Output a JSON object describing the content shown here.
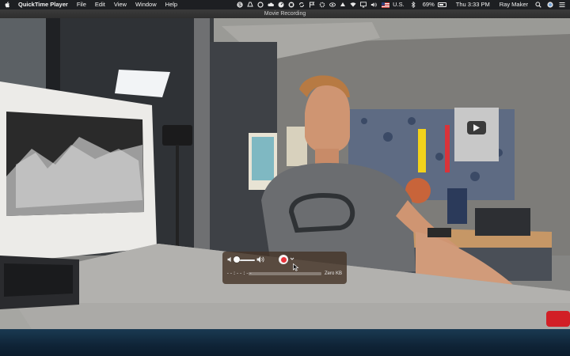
{
  "menubar": {
    "app_name": "QuickTime Player",
    "menus": [
      "File",
      "Edit",
      "View",
      "Window",
      "Help"
    ],
    "status": {
      "battery_percent": 69,
      "battery_label": "69%",
      "input_source": "U.S.",
      "clock": "Thu 3:33 PM",
      "user": "Ray Maker"
    },
    "icons": [
      "skype-icon",
      "drive-icon",
      "sync-icon",
      "cloud-icon",
      "gauge-icon",
      "record-status-icon",
      "sync-icon",
      "flag-icon",
      "settings-icon",
      "eye-icon",
      "up-arrow-icon",
      "wifi-icon",
      "airplay-icon",
      "sound-icon",
      "flag-icon",
      "battery-icon",
      "search-icon",
      "siri-icon",
      "notifications-icon"
    ]
  },
  "window": {
    "title": "Movie Recording"
  },
  "hud": {
    "timer": "--:--:--",
    "size": "Zero KB"
  }
}
